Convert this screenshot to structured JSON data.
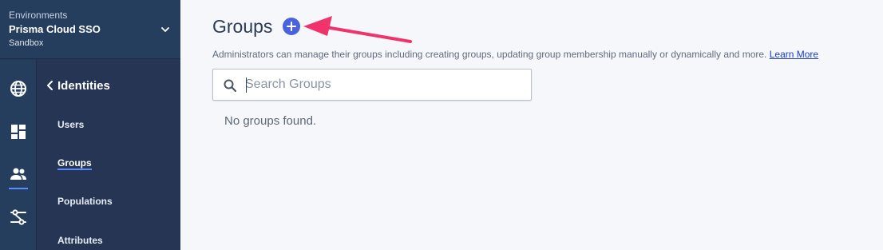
{
  "environment": {
    "caption": "Environments",
    "name": "Prisma Cloud SSO",
    "type": "Sandbox"
  },
  "icon_rail": [
    {
      "icon": "globe-icon"
    },
    {
      "icon": "dashboard-icon"
    },
    {
      "icon": "users-icon",
      "active": true
    },
    {
      "icon": "connections-icon"
    }
  ],
  "nav": {
    "title": "Identities",
    "items": [
      {
        "label": "Users"
      },
      {
        "label": "Groups",
        "active": true
      },
      {
        "label": "Populations"
      },
      {
        "label": "Attributes"
      }
    ]
  },
  "main": {
    "title": "Groups",
    "description": "Administrators can manage their groups including creating groups, updating group membership manually or dynamically and more.",
    "learn_more": "Learn More",
    "search": {
      "placeholder": "Search Groups",
      "value": ""
    },
    "empty_message": "No groups found."
  },
  "colors": {
    "sidebar": "#253553",
    "accent": "#4a63dc",
    "arrow": "#f0336a"
  }
}
